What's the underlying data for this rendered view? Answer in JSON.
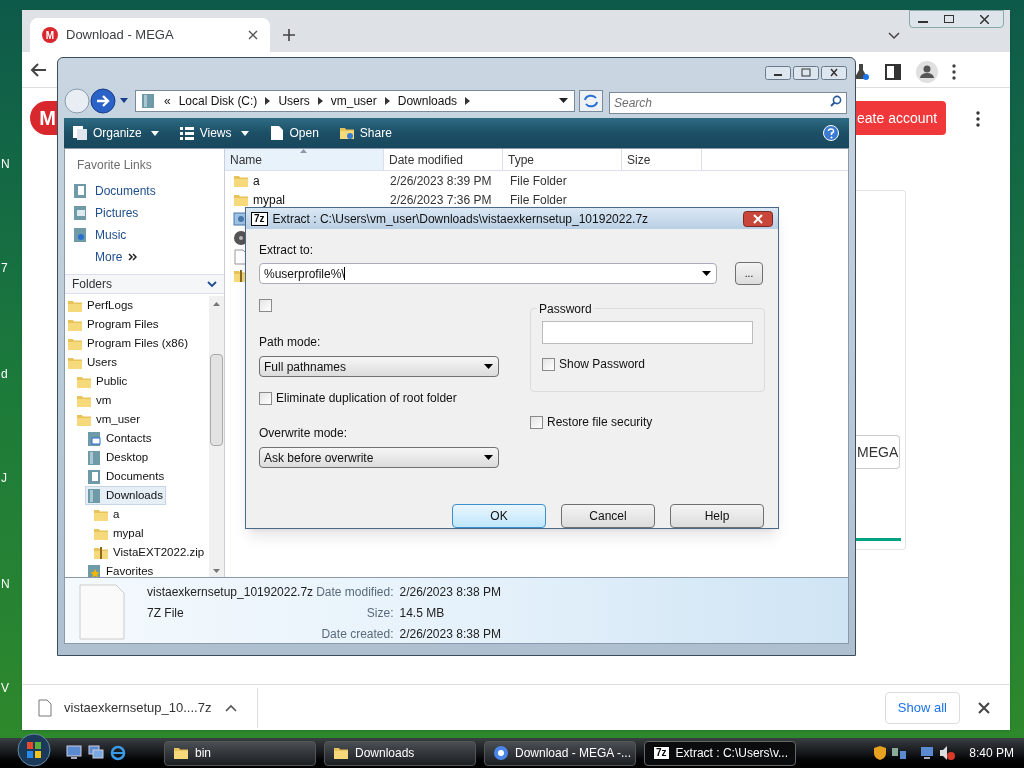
{
  "desktop": {
    "edge_letters": [
      "N",
      "7",
      "d",
      "J",
      "N",
      "V"
    ]
  },
  "browser": {
    "tab": {
      "title": "Download - MEGA",
      "logo": "M"
    },
    "page": {
      "logo": "M",
      "create_account": "eate account",
      "mega_button": "MEGA"
    },
    "download_bar": {
      "file": "vistaexkernsetup_10....7z",
      "show_all": "Show all"
    }
  },
  "explorer": {
    "breadcrumb_overflow": "«",
    "breadcrumb": [
      "Local Disk (C:)",
      "Users",
      "vm_user",
      "Downloads"
    ],
    "search": {
      "placeholder": "Search"
    },
    "toolbar": [
      {
        "label": "Organize",
        "kind": "organize",
        "dropdown": true
      },
      {
        "label": "Views",
        "kind": "views",
        "dropdown": true
      },
      {
        "label": "Open",
        "kind": "open",
        "dropdown": false
      },
      {
        "label": "Share",
        "kind": "share",
        "dropdown": false
      }
    ],
    "favorite_links": {
      "title": "Favorite Links",
      "items": [
        {
          "label": "Documents",
          "kind": "documents"
        },
        {
          "label": "Pictures",
          "kind": "pictures"
        },
        {
          "label": "Music",
          "kind": "music"
        }
      ],
      "more": "More"
    },
    "folders": {
      "title": "Folders",
      "tree": [
        {
          "label": "PerfLogs",
          "kind": "folder",
          "selected": false
        },
        {
          "label": "Program Files",
          "kind": "folder",
          "selected": false
        },
        {
          "label": "Program Files (x86)",
          "kind": "folder",
          "selected": false
        },
        {
          "label": "Users",
          "kind": "folder",
          "selected": false,
          "children": [
            {
              "label": "Public",
              "kind": "folder",
              "selected": false
            },
            {
              "label": "vm",
              "kind": "folder",
              "selected": false
            },
            {
              "label": "vm_user",
              "kind": "folder",
              "selected": false,
              "children": [
                {
                  "label": "Contacts",
                  "kind": "contacts",
                  "selected": false
                },
                {
                  "label": "Desktop",
                  "kind": "library",
                  "selected": false
                },
                {
                  "label": "Documents",
                  "kind": "documents",
                  "selected": false
                },
                {
                  "label": "Downloads",
                  "kind": "library",
                  "selected": true,
                  "children": [
                    {
                      "label": "a",
                      "kind": "folder",
                      "selected": false
                    },
                    {
                      "label": "mypal",
                      "kind": "folder",
                      "selected": false
                    },
                    {
                      "label": "VistaEXT2022.zip",
                      "kind": "zip",
                      "selected": false
                    }
                  ]
                },
                {
                  "label": "Favorites",
                  "kind": "favorites",
                  "selected": false
                }
              ]
            }
          ]
        }
      ]
    },
    "columns": [
      "Name",
      "Date modified",
      "Type",
      "Size"
    ],
    "rows": [
      {
        "kind": "folder",
        "name": "a",
        "date": "2/26/2023 8:39 PM",
        "type": "File Folder"
      },
      {
        "kind": "folder",
        "name": "mypal",
        "date": "2/26/2023 7:36 PM",
        "type": "File Folder"
      },
      {
        "kind": "setup"
      },
      {
        "kind": "disc"
      },
      {
        "kind": "file"
      },
      {
        "kind": "zip"
      }
    ],
    "details": {
      "name": "vistaexkernsetup_10192022.7z",
      "type": "7Z File",
      "fields": [
        {
          "label": "Date modified:",
          "value": "2/26/2023 8:38 PM"
        },
        {
          "label": "Size:",
          "value": "14.5 MB"
        },
        {
          "label": "Date created:",
          "value": "2/26/2023 8:38 PM"
        }
      ]
    }
  },
  "dialog": {
    "title": "Extract : C:\\Users\\vm_user\\Downloads\\vistaexkernsetup_10192022.7z",
    "app_icon": "7z",
    "extract_to": {
      "label": "Extract to:",
      "value": "%userprofile%\\"
    },
    "browse": "...",
    "unlabeled_checkbox": {
      "checked": false
    },
    "path_mode": {
      "label": "Path mode:",
      "value": "Full pathnames"
    },
    "eliminate": {
      "label": "Eliminate duplication of root folder",
      "checked": false
    },
    "overwrite_mode": {
      "label": "Overwrite mode:",
      "value": "Ask before overwrite"
    },
    "password": {
      "title": "Password",
      "show": {
        "label": "Show Password",
        "checked": false
      }
    },
    "restore": {
      "label": "Restore file security",
      "checked": false
    },
    "buttons": [
      {
        "label": "OK",
        "default": true
      },
      {
        "label": "Cancel",
        "default": false
      },
      {
        "label": "Help",
        "default": false
      }
    ]
  },
  "taskbar": {
    "buttons": [
      {
        "label": "bin",
        "kind": "folder",
        "selected": false
      },
      {
        "label": "Downloads",
        "kind": "folder",
        "selected": false
      },
      {
        "label": "Download - MEGA -...",
        "kind": "chrome",
        "selected": false
      },
      {
        "label": "Extract : C:\\Users\\v...",
        "kind": "7z",
        "selected": true
      }
    ],
    "clock": "8:40 PM"
  }
}
